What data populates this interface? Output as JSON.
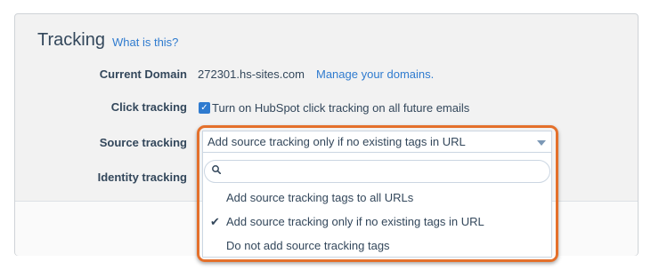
{
  "section": {
    "title": "Tracking",
    "help_link": "What is this?"
  },
  "fields": {
    "current_domain": {
      "label": "Current Domain",
      "value": "272301.hs-sites.com",
      "link": "Manage your domains."
    },
    "click_tracking": {
      "label": "Click tracking",
      "checkbox_label": "Turn on HubSpot click tracking on all future emails",
      "checked": true
    },
    "source_tracking": {
      "label": "Source tracking",
      "selected": "Add source tracking only if no existing tags in URL",
      "search_placeholder": "",
      "options": [
        "Add source tracking tags to all URLs",
        "Add source tracking only if no existing tags in URL",
        "Do not add source tracking tags"
      ]
    },
    "identity_tracking": {
      "label": "Identity tracking"
    }
  },
  "colors": {
    "accent": "#2f7bcf",
    "highlight": "#e4702b",
    "text": "#33475b"
  }
}
